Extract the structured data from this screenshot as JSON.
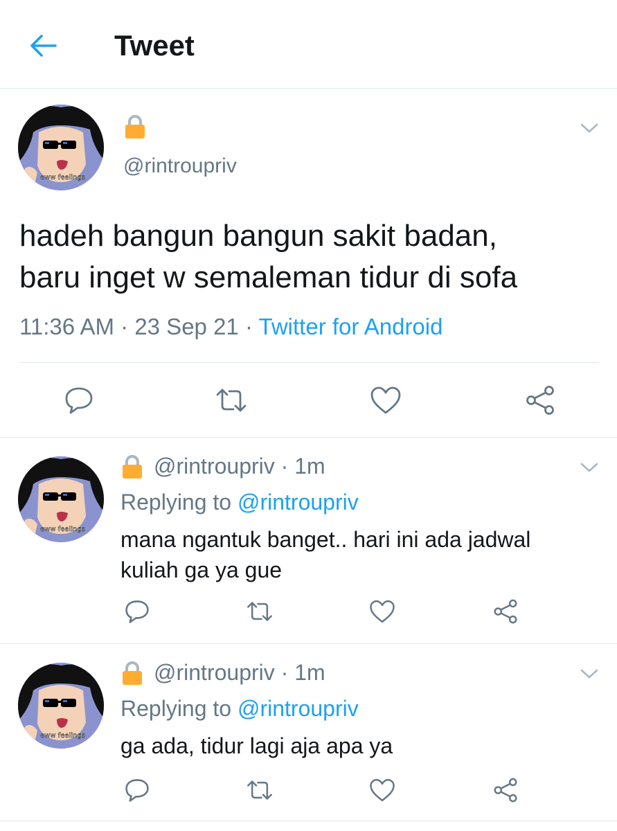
{
  "header": {
    "title": "Tweet"
  },
  "main_tweet": {
    "handle": "@rintroupriv",
    "text_line1": "hadeh bangun bangun sakit badan,",
    "text_line2": "baru inget w semaleman tidur di sofa",
    "time": "11:36 AM",
    "sep1": " · ",
    "date": "23 Sep 21",
    "sep2": " · ",
    "source": "Twitter for Android"
  },
  "avatar": {
    "caption": "eww feelings"
  },
  "replies": [
    {
      "handle": "@rintroupriv",
      "time": "· 1m",
      "replying_prefix": "Replying to ",
      "replying_to": "@rintroupriv",
      "text_line1": "mana ngantuk banget.. hari ini ada jadwal",
      "text_line2": "kuliah ga ya gue"
    },
    {
      "handle": "@rintroupriv",
      "time": "· 1m",
      "replying_prefix": "Replying to ",
      "replying_to": "@rintroupriv",
      "text_line1": "ga ada, tidur lagi aja apa ya",
      "text_line2": ""
    }
  ],
  "icons": {
    "back": "arrow-left-icon",
    "lock": "lock-icon",
    "more": "chevron-down-icon",
    "reply": "reply-icon",
    "retweet": "retweet-icon",
    "like": "heart-icon",
    "share": "share-icon"
  },
  "colors": {
    "accent": "#1da1f2",
    "text": "#14171a",
    "secondary": "#657786",
    "divider": "#e1e8ed",
    "lock": "#ffac33"
  }
}
